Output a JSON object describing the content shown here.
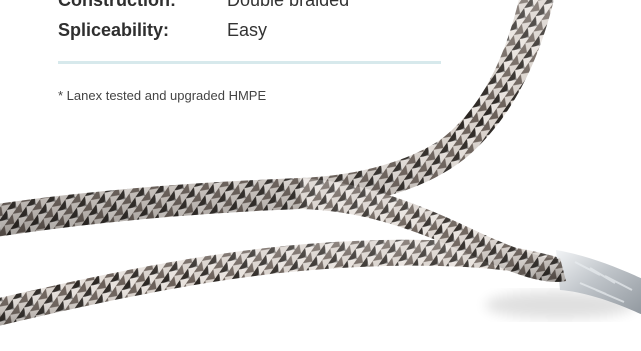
{
  "specs": {
    "construction_label": "Construction:",
    "construction_value": "Double braided",
    "spliceability_label": "Spliceability:",
    "spliceability_value": "Easy"
  },
  "footnote": "* Lanex tested and upgraded HMPE",
  "colors": {
    "rule": "#d7e9ec",
    "rope_light": "#d9d2cc",
    "rope_dark": "#2b2622",
    "core_silver": "#c9cdd1"
  },
  "image": {
    "subject": "braided-rope"
  }
}
